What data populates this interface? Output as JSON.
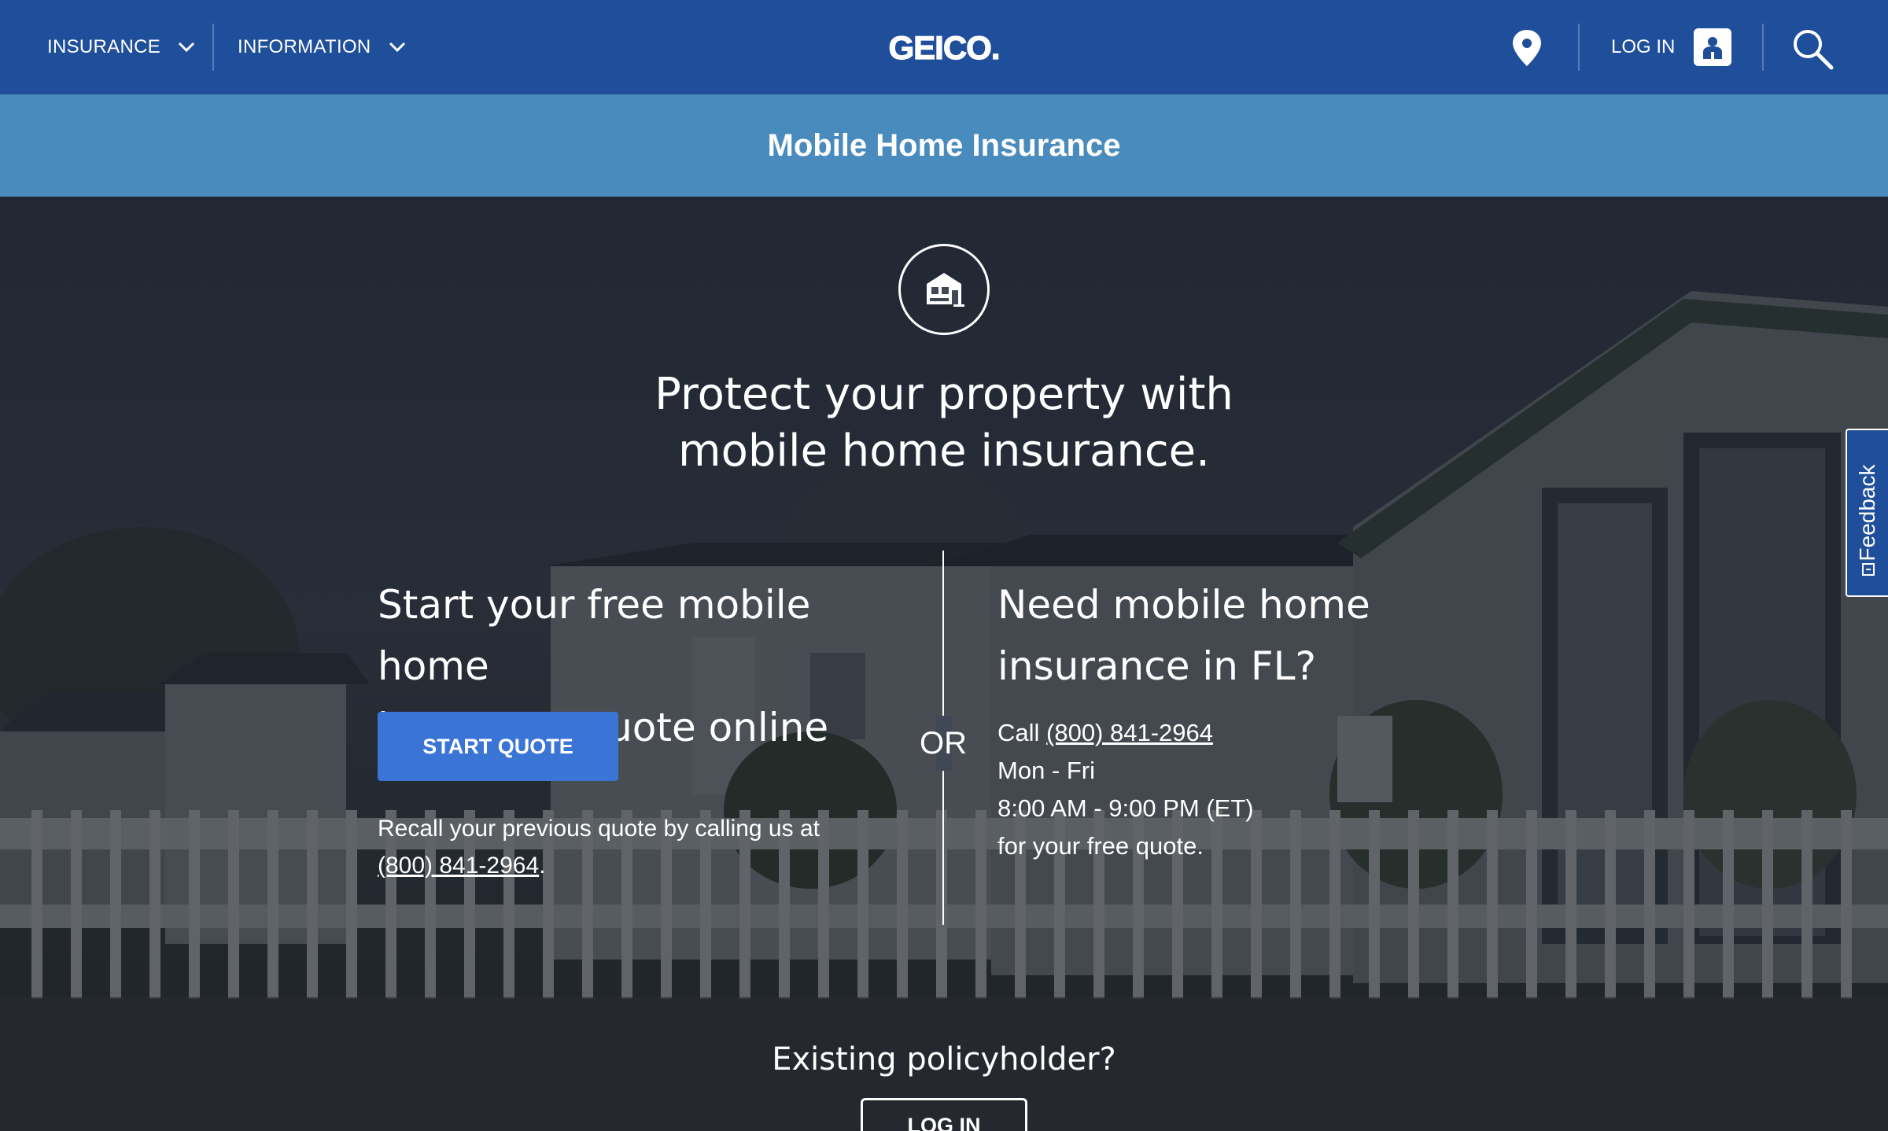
{
  "nav": {
    "insurance_label": "INSURANCE",
    "information_label": "INFORMATION",
    "logo_text": "GEICO.",
    "login_label": "LOG IN"
  },
  "title_bar": {
    "title": "Mobile Home Insurance"
  },
  "hero": {
    "headline_line1": "Protect your property with",
    "headline_line2": "mobile home insurance.",
    "left": {
      "heading_line1": "Start your free mobile home",
      "heading_line2": "insurance quote online",
      "button_label": "START QUOTE",
      "recall_text": "Recall your previous quote by calling us at",
      "recall_phone": "(800) 841-2964",
      "recall_end": "."
    },
    "or_label": "OR",
    "right": {
      "heading_line1": "Need mobile home",
      "heading_line2": "insurance in FL?",
      "call_prefix": "Call ",
      "phone": "(800) 841-2964",
      "days": "Mon - Fri",
      "hours": "8:00 AM - 9:00 PM (ET)",
      "closing": "for your free quote."
    },
    "policyholder_question": "Existing policyholder?",
    "policyholder_button": "LOG IN"
  },
  "feedback": {
    "label": "Feedback"
  },
  "colors": {
    "nav_bg": "#1f4f9a",
    "title_bar_bg": "#4a8bbd",
    "button_blue": "#3a74d4",
    "text_white": "#ffffff"
  },
  "icons": {
    "nav_chevron": "chevron-down-icon",
    "location": "location-pin-icon",
    "user": "user-icon",
    "search": "search-icon",
    "house": "mobile-home-icon",
    "feedback": "feedback-icon"
  }
}
